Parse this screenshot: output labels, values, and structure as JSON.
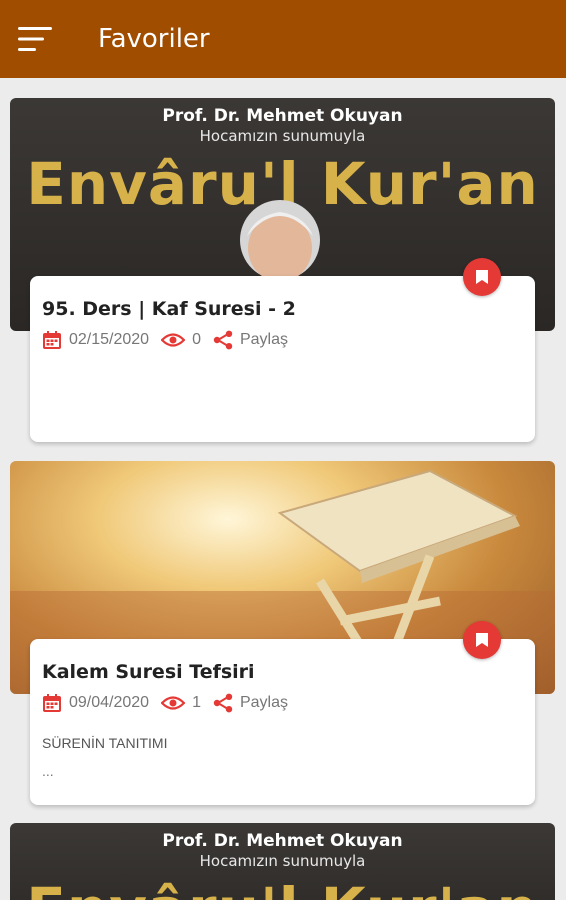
{
  "appbar": {
    "title": "Favoriler",
    "color": "#a04d00"
  },
  "items": [
    {
      "banner_line1": "Prof. Dr. Mehmet Okuyan",
      "banner_line2": "Hocamızın sunumuyla",
      "banner_title": "Envâru'l Kur'an",
      "title": "95. Ders | Kaf Suresi - 2",
      "date": "02/15/2020",
      "views": "0",
      "share_label": "Paylaş",
      "description": "",
      "description_more": ""
    },
    {
      "title": "Kalem Suresi Tefsiri",
      "date": "09/04/2020",
      "views": "1",
      "share_label": "Paylaş",
      "description": "SÜRENİN TANITIMI",
      "description_more": "..."
    },
    {
      "banner_line1": "Prof. Dr. Mehmet Okuyan",
      "banner_line2": "Hocamızın sunumuyla",
      "banner_title": "Envâru'l Kur'an"
    }
  ],
  "colors": {
    "accent": "#e53935",
    "banner_gold": "#d7b24a"
  },
  "icons": [
    "menu-icon",
    "calendar-icon",
    "eye-icon",
    "share-icon",
    "bookmark-icon"
  ]
}
